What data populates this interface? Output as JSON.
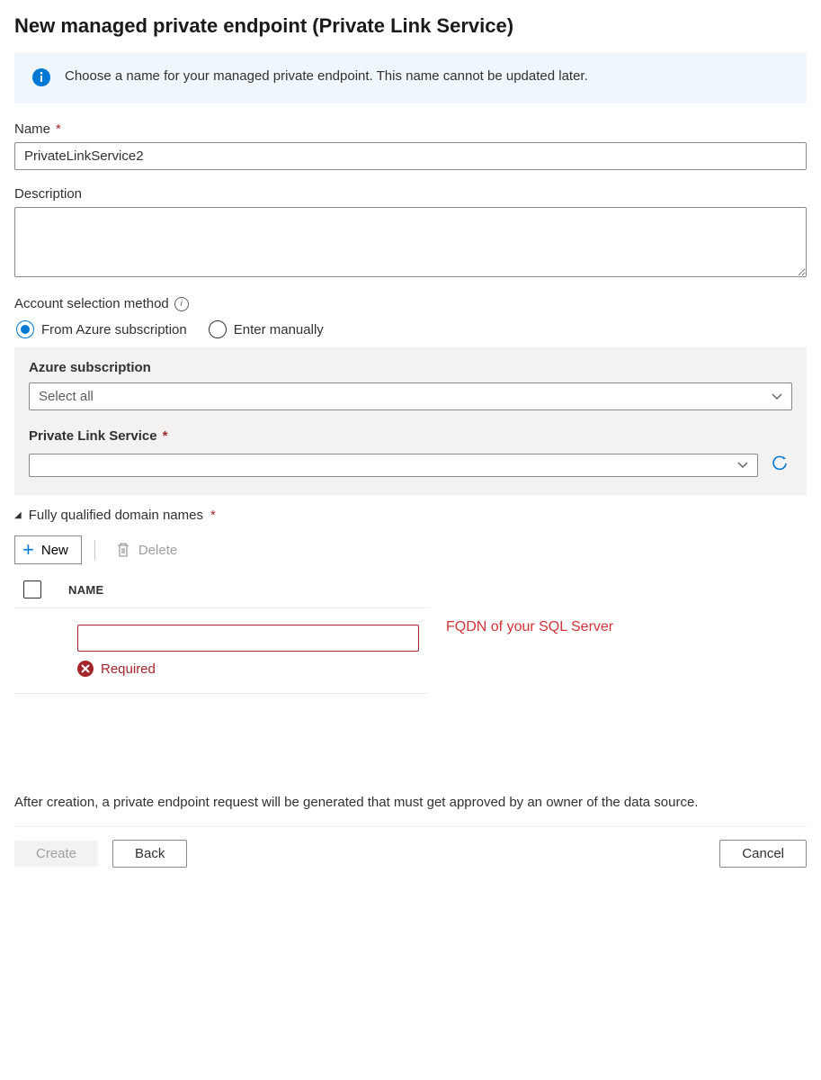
{
  "title": "New managed private endpoint (Private Link Service)",
  "info_message": "Choose a name for your managed private endpoint. This name cannot be updated later.",
  "name": {
    "label": "Name",
    "value": "PrivateLinkService2"
  },
  "description": {
    "label": "Description",
    "value": ""
  },
  "account_method": {
    "label": "Account selection method",
    "options": {
      "from_sub": "From Azure subscription",
      "manual": "Enter manually"
    },
    "selected": "from_sub"
  },
  "subscription": {
    "label": "Azure subscription",
    "value": "Select all"
  },
  "pls": {
    "label": "Private Link Service",
    "value": ""
  },
  "fqdn": {
    "header": "Fully qualified domain names",
    "new_btn": "New",
    "delete_btn": "Delete",
    "col_name": "NAME",
    "row": {
      "value": "",
      "error": "Required"
    },
    "annotation": "FQDN of your SQL Server"
  },
  "footer_note": "After creation, a private endpoint request will be generated that must get approved by an owner of the data source.",
  "buttons": {
    "create": "Create",
    "back": "Back",
    "cancel": "Cancel"
  }
}
